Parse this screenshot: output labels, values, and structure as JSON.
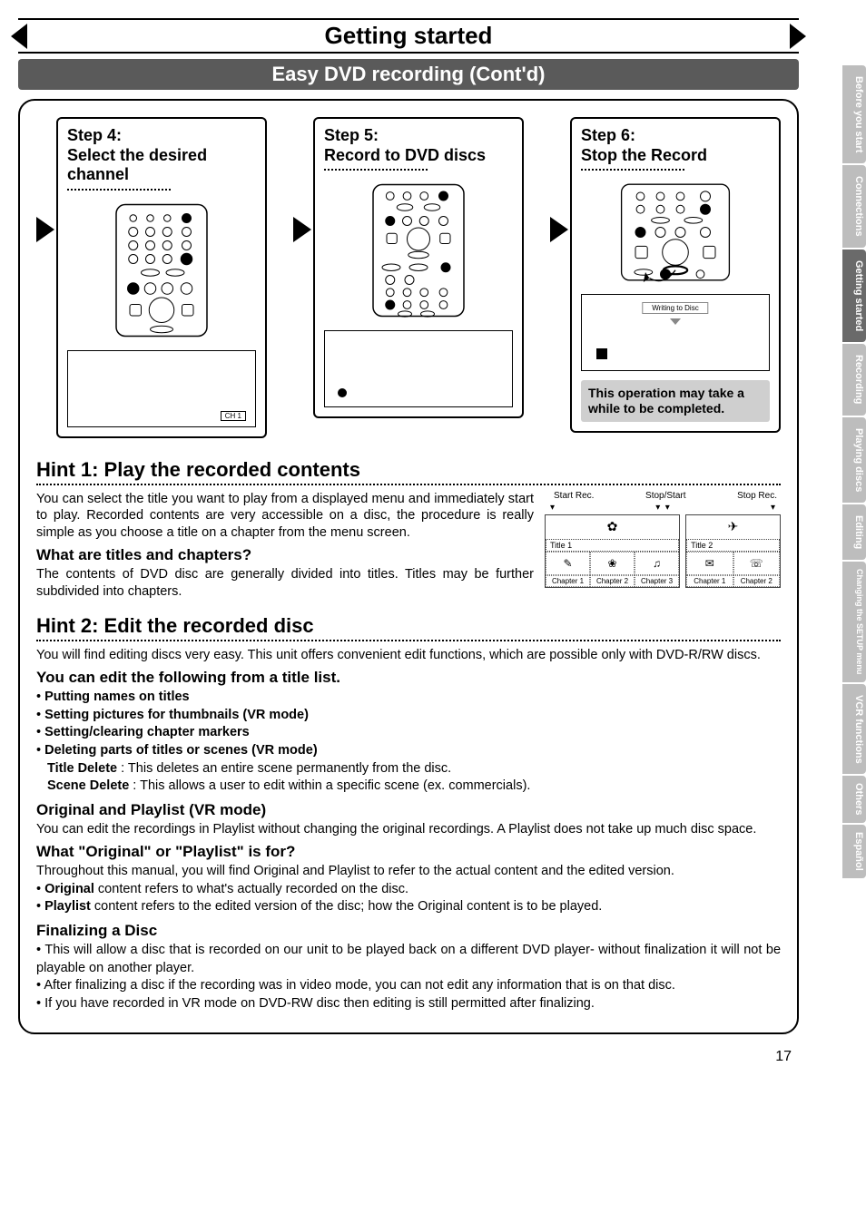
{
  "ribbon_title": "Getting started",
  "section_bar": "Easy DVD recording (Cont'd)",
  "steps": {
    "s4": {
      "heading": "Step 4:\nSelect the desired channel",
      "tv_label": "CH 1"
    },
    "s5": {
      "heading": "Step 5:\nRecord to DVD discs"
    },
    "s6": {
      "heading": "Step 6:\nStop the Record",
      "writing": "Writing to Disc",
      "note": "This operation may take a while to be completed."
    }
  },
  "hint1": {
    "heading": "Hint 1: Play the recorded contents",
    "p1": "You can select the title you want to play from a displayed menu and immediately start to play. Recorded contents are very accessible on a disc, the procedure is really simple as you choose a title on a chapter from the menu screen.",
    "sub": "What are titles and chapters?",
    "p2": "The contents of DVD disc are generally divided into titles. Titles may be further subdivided into chapters.",
    "diagram": {
      "markers": [
        "Start Rec.",
        "Stop/Start",
        "Stop Rec."
      ],
      "title1": "Title 1",
      "title2": "Title 2",
      "t1_ch": [
        "Chapter 1",
        "Chapter 2",
        "Chapter 3"
      ],
      "t2_ch": [
        "Chapter 1",
        "Chapter 2"
      ]
    }
  },
  "hint2": {
    "heading": "Hint 2: Edit the recorded disc",
    "p1": "You will find editing discs very easy. This unit offers convenient edit functions, which are possible only with DVD-R/RW discs.",
    "edit_head": "You can edit the following from a title list.",
    "bullets": [
      "Putting names on titles",
      "Setting pictures for thumbnails (VR mode)",
      "Setting/clearing chapter markers",
      "Deleting parts of titles or scenes (VR mode)"
    ],
    "title_delete_label": "Title Delete",
    "title_delete_text": " : This deletes an entire scene permanently from the disc.",
    "scene_delete_label": "Scene Delete",
    "scene_delete_text": " : This allows a user to edit within a specific scene (ex. commercials).",
    "orig_head": "Original and Playlist (VR mode)",
    "orig_p": "You can edit the recordings in Playlist without changing the original recordings.  A Playlist does not take up much disc space.",
    "what_head": "What \"Original\" or \"Playlist\" is for?",
    "what_p": "Throughout this manual, you will find Original and Playlist to refer to the actual content and the edited version.",
    "what_b1_label": "Original",
    "what_b1_text": " content refers to what's actually recorded on the disc.",
    "what_b2_label": "Playlist",
    "what_b2_text": " content refers to the edited version of the disc; how the Original content is to be played.",
    "fin_head": "Finalizing a Disc",
    "fin_b1": "This will allow a disc that is recorded on our unit to be played back on a different DVD player- without finalization it will not be playable on another player.",
    "fin_b2": "After finalizing a disc if the recording was in video mode, you can not edit any information that is on that disc.",
    "fin_b3": "If you have recorded in VR mode on DVD-RW disc then editing is still permitted after finalizing."
  },
  "page_number": "17",
  "tabs": [
    "Before you start",
    "Connections",
    "Getting started",
    "Recording",
    "Playing discs",
    "Editing",
    "Changing the SETUP menu",
    "VCR functions",
    "Others",
    "Español"
  ],
  "chart_data": {
    "type": "table",
    "title": "Titles and chapters structure",
    "series": [
      {
        "name": "Title 1",
        "values": [
          "Chapter 1",
          "Chapter 2",
          "Chapter 3"
        ]
      },
      {
        "name": "Title 2",
        "values": [
          "Chapter 1",
          "Chapter 2"
        ]
      }
    ],
    "markers": [
      "Start Rec.",
      "Stop/Start",
      "Stop Rec."
    ]
  }
}
